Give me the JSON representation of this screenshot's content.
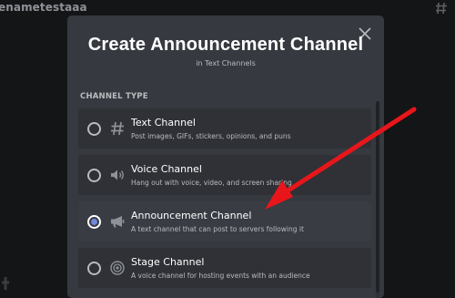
{
  "background": {
    "server_title": "enametestaaa"
  },
  "modal": {
    "title": "Create Announcement Channel",
    "subtitle": "in Text Channels",
    "section_label": "CHANNEL TYPE",
    "options": [
      {
        "title": "Text Channel",
        "description": "Post images, GIFs, stickers, opinions, and puns",
        "icon": "hashtag-icon",
        "selected": false
      },
      {
        "title": "Voice Channel",
        "description": "Hang out with voice, video, and screen sharing",
        "icon": "speaker-icon",
        "selected": false
      },
      {
        "title": "Announcement Channel",
        "description": "A text channel that can post to servers following it",
        "icon": "megaphone-icon",
        "selected": true
      },
      {
        "title": "Stage Channel",
        "description": "A voice channel for hosting events with an audience",
        "icon": "stage-icon",
        "selected": false
      }
    ]
  },
  "colors": {
    "accent": "#7289da",
    "annotation_arrow": "#e8161b"
  }
}
